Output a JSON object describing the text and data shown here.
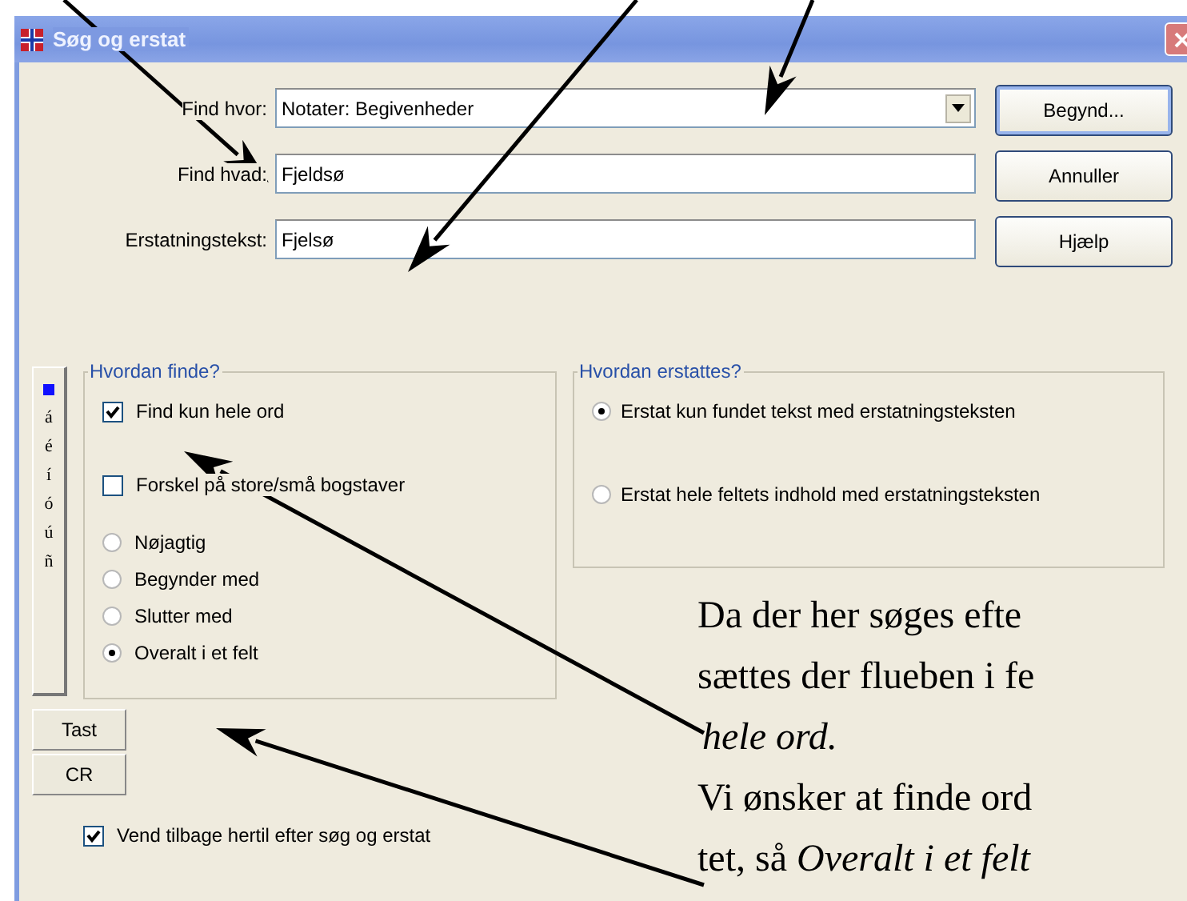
{
  "window": {
    "title": "Søg og erstat"
  },
  "fields": [
    {
      "label": "Find hvor:",
      "value": "Notater: Begivenheder",
      "kind": "dropdown"
    },
    {
      "label": "Find hvad:",
      "value": "Fjeldsø",
      "kind": "text"
    },
    {
      "label": "Erstatningstekst:",
      "value": "Fjelsø",
      "kind": "text"
    }
  ],
  "buttons": [
    {
      "label": "Begynd...",
      "default": true
    },
    {
      "label": "Annuller",
      "default": false
    },
    {
      "label": "Hjælp",
      "default": false
    }
  ],
  "char_strip": {
    "items": [
      "á",
      "é",
      "í",
      "ó",
      "ú",
      "ñ"
    ]
  },
  "key_buttons": [
    "Tast",
    "CR"
  ],
  "find_group": {
    "title": "Hvordan finde?",
    "options": [
      {
        "kind": "checkbox",
        "label": "Find kun hele ord",
        "checked": true
      },
      {
        "kind": "checkbox",
        "label": "Forskel på store/små bogstaver",
        "checked": false
      },
      {
        "kind": "radio",
        "label": "Nøjagtig",
        "selected": false
      },
      {
        "kind": "radio",
        "label": "Begynder med",
        "selected": false
      },
      {
        "kind": "radio",
        "label": "Slutter med",
        "selected": false
      },
      {
        "kind": "radio",
        "label": "Overalt i et felt",
        "selected": true
      }
    ]
  },
  "replace_group": {
    "title": "Hvordan erstattes?",
    "options": [
      {
        "label": "Erstat kun fundet tekst med erstatningsteksten",
        "selected": true
      },
      {
        "label": "Erstat hele feltets indhold med erstatningsteksten",
        "selected": false
      }
    ]
  },
  "return_check": {
    "label": "Vend tilbage hertil efter søg og erstat",
    "checked": true
  },
  "annotation": {
    "lines": [
      {
        "text": "Da der her søges efte",
        "italic": false
      },
      {
        "text": "sættes der flueben i fe",
        "italic": false
      },
      {
        "text": "hele ord.",
        "italic": true
      },
      {
        "text": "Vi ønsker at finde ord",
        "italic": false
      },
      {
        "text": "tet, så *Overalt i et felt*",
        "italic": false
      }
    ]
  }
}
